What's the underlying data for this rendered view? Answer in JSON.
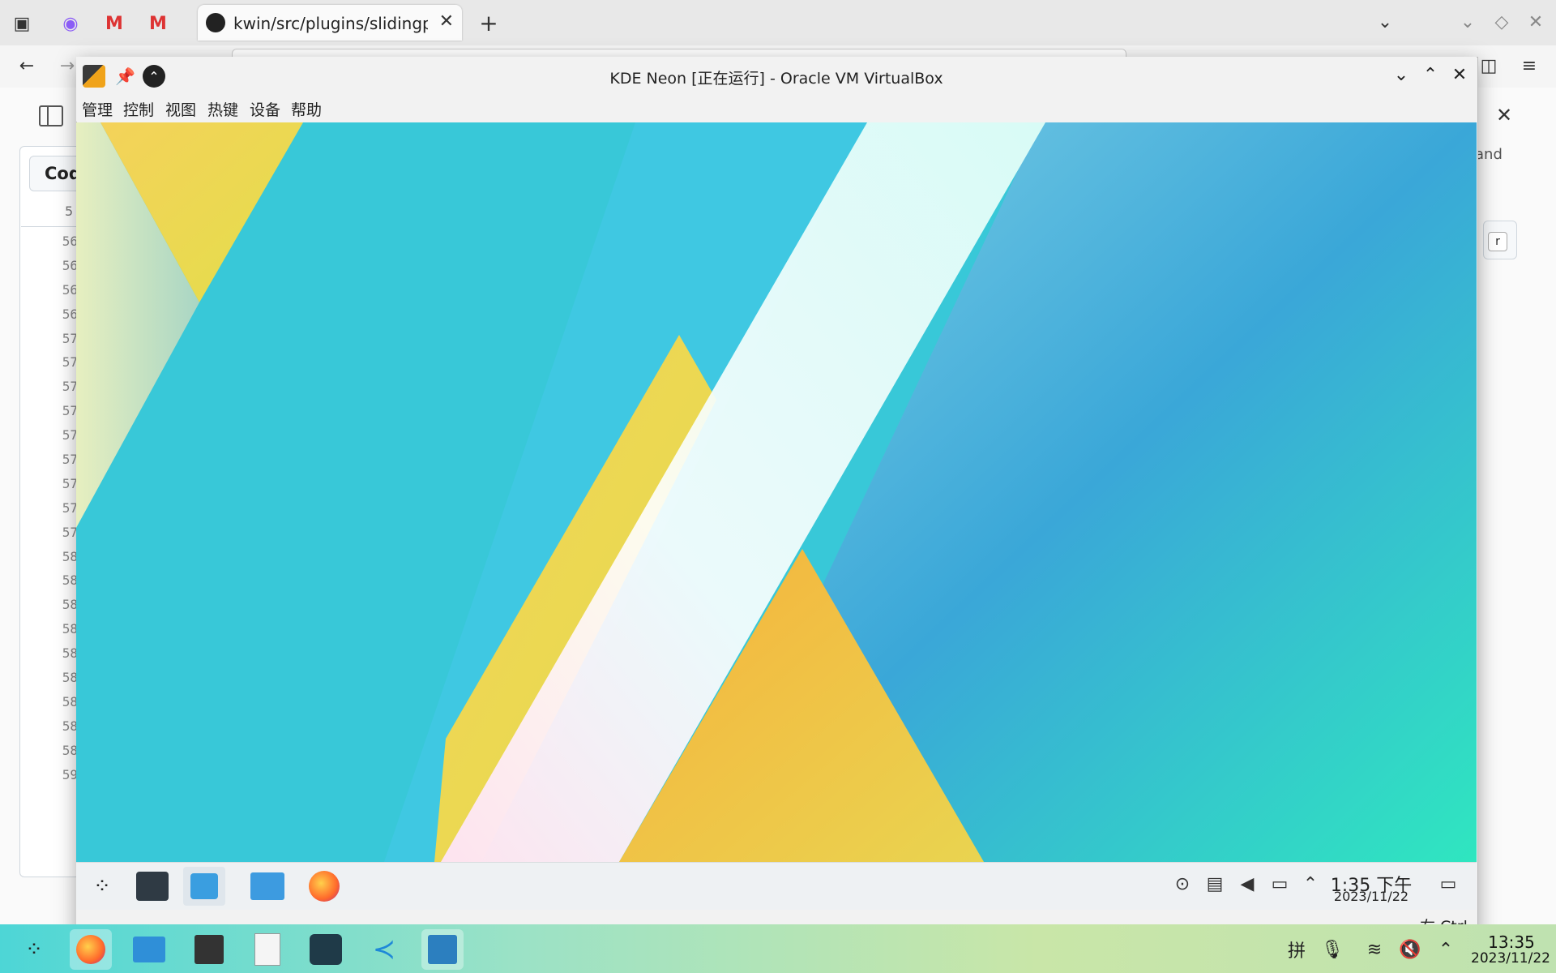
{
  "browser": {
    "active_tab_title": "kwin/src/plugins/slidingpo",
    "new_tab_glyph": "+",
    "tab_close_glyph": "✕",
    "icons": [
      "tab-overview-icon",
      "discord-icon",
      "gmail-icon",
      "gmail-icon",
      "github-icon",
      "new-tab-icon",
      "list-all-tabs-icon",
      "back-icon",
      "forward-icon",
      "sidebar-icon",
      "menu-icon"
    ]
  },
  "github_page": {
    "code_button_label": "Cod",
    "first_line_label": "5",
    "line_numbers": [
      "56",
      "56",
      "56",
      "56",
      "57",
      "57",
      "57",
      "57",
      "57",
      "57",
      "57",
      "57",
      "57",
      "58",
      "58",
      "58",
      "58",
      "58",
      "58",
      "58",
      "58",
      "58",
      "59"
    ],
    "right_fragment_text": "and",
    "right_fragment_key": "r"
  },
  "vbox": {
    "window_title": "KDE Neon [正在运行] - Oracle VM VirtualBox",
    "menu": [
      "管理",
      "控制",
      "视图",
      "热键",
      "设备",
      "帮助"
    ],
    "host_key_label": "右 Ctrl"
  },
  "guest": {
    "panel_apps": [
      "application-launcher-icon",
      "system-settings-icon",
      "discover-icon",
      "dolphin-folder-icon",
      "firefox-icon"
    ],
    "tray_icons": [
      "updates-icon",
      "clipboard-icon",
      "volume-icon",
      "network-icon",
      "expand-tray-icon"
    ],
    "clock_time": "1:35 下午",
    "clock_date": "2023/11/22"
  },
  "host_taskbar": {
    "apps": [
      "application-launcher-icon",
      "firefox-icon",
      "file-manager-icon",
      "terminal-icon",
      "text-editor-icon",
      "app-icon",
      "vscode-icon",
      "virtualbox-icon"
    ],
    "tray_text": "拼",
    "clock_time": "13:35",
    "clock_date": "2023/11/22"
  },
  "colors": {
    "guest_teal": "#34c8d8",
    "guest_yellow": "#e7d64a",
    "guest_orange": "#f2a93b",
    "host_taskbar_start": "#4dd6d6"
  }
}
